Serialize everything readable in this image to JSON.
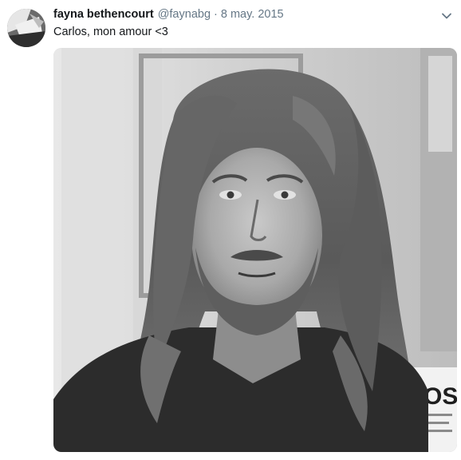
{
  "tweet": {
    "display_name": "fayna bethencourt",
    "handle": "@faynabg",
    "separator": "·",
    "date": "8 may. 2015",
    "text": "Carlos, mon amour <3"
  },
  "icons": {
    "caret": "chevron-down-icon"
  },
  "photo": {
    "sign_text": "SOS"
  }
}
